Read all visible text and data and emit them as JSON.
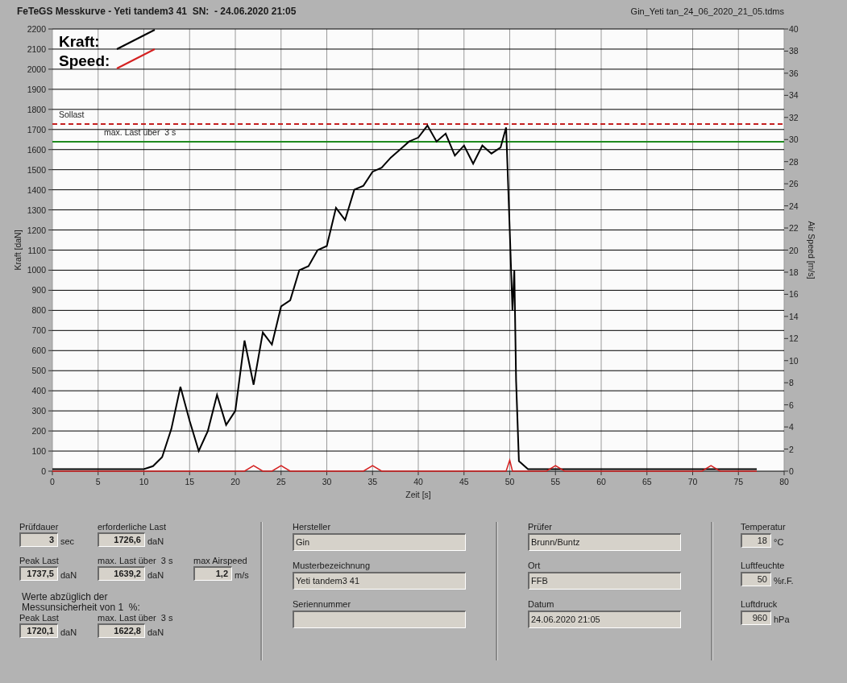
{
  "title": "FeTeGS Messkurve - Yeti tandem3 41  SN:  - 24.06.2020 21:05",
  "file_name": "Gin_Yeti tan_24_06_2020_21_05.tdms",
  "chart": {
    "chart_data": {
      "type": "line",
      "xlabel": "Zeit [s]",
      "ylabel": "Kraft [daN]",
      "y2label": "Air Speed [m/s]",
      "x": [
        0,
        1,
        2,
        3,
        4,
        5,
        6,
        7,
        8,
        9,
        10,
        11,
        12,
        13,
        14,
        15,
        16,
        17,
        18,
        19,
        20,
        21,
        22,
        23,
        24,
        25,
        26,
        27,
        28,
        29,
        30,
        31,
        32,
        33,
        34,
        35,
        36,
        37,
        38,
        39,
        40,
        41,
        42,
        43,
        44,
        45,
        46,
        47,
        48,
        49,
        49.6,
        50,
        50.3,
        50.5,
        50.7,
        51,
        52,
        53,
        54,
        55,
        56,
        57,
        58,
        59,
        60,
        61,
        62,
        63,
        64,
        65,
        66,
        67,
        68,
        69,
        70,
        71,
        72,
        73,
        74,
        75,
        76,
        77
      ],
      "series": [
        {
          "name": "Kraft:",
          "color": "#000000",
          "values": [
            10,
            10,
            10,
            10,
            10,
            10,
            10,
            10,
            10,
            10,
            10,
            25,
            70,
            210,
            420,
            250,
            100,
            200,
            380,
            230,
            300,
            650,
            430,
            690,
            630,
            820,
            850,
            1000,
            1020,
            1100,
            1120,
            1310,
            1250,
            1400,
            1420,
            1490,
            1510,
            1560,
            1600,
            1640,
            1660,
            1720,
            1640,
            1680,
            1570,
            1620,
            1530,
            1620,
            1580,
            1610,
            1710,
            1200,
            800,
            1000,
            450,
            50,
            10,
            10,
            10,
            10,
            10,
            10,
            10,
            10,
            10,
            10,
            10,
            10,
            10,
            10,
            10,
            10,
            10,
            10,
            10,
            10,
            10,
            10,
            10,
            10,
            10,
            10
          ]
        },
        {
          "name": "Speed:",
          "color": "#d42020",
          "axis": "y2",
          "values": [
            0,
            0,
            0,
            0,
            0,
            0,
            0,
            0,
            0,
            0,
            0,
            0,
            0,
            0,
            0,
            0,
            0,
            0,
            0,
            0,
            0,
            0,
            0.5,
            0,
            0,
            0.5,
            0,
            0,
            0,
            0,
            0,
            0,
            0,
            0,
            0,
            0.5,
            0,
            0,
            0,
            0,
            0,
            0,
            0,
            0,
            0,
            0,
            0,
            0,
            0,
            0,
            0,
            1,
            0,
            0,
            0,
            0,
            0,
            0,
            0,
            0.5,
            0,
            0,
            0,
            0,
            0,
            0,
            0,
            0,
            0,
            0,
            0,
            0,
            0,
            0,
            0,
            0,
            0.5,
            0,
            0,
            0,
            0,
            0
          ]
        }
      ],
      "xlim": [
        0,
        80
      ],
      "ylim": [
        0,
        2200
      ],
      "y2lim": [
        0,
        40
      ],
      "xticks": [
        0,
        5,
        10,
        15,
        20,
        25,
        30,
        35,
        40,
        45,
        50,
        55,
        60,
        65,
        70,
        75,
        80
      ],
      "yticks": [
        0,
        100,
        200,
        300,
        400,
        500,
        600,
        700,
        800,
        900,
        1000,
        1100,
        1200,
        1300,
        1400,
        1500,
        1600,
        1700,
        1800,
        1900,
        2000,
        2100,
        2200
      ],
      "y2ticks": [
        0,
        2,
        4,
        6,
        8,
        10,
        12,
        14,
        16,
        18,
        20,
        22,
        24,
        26,
        28,
        30,
        32,
        34,
        36,
        38,
        40
      ],
      "grid": true,
      "legend": "upper left",
      "ref_lines": [
        {
          "axis": "y",
          "value": 1727,
          "label": "Sollast",
          "color": "#c42020"
        },
        {
          "axis": "y",
          "value": 1639,
          "label": "max. Last über  3 s",
          "color": "#1e8a1e"
        }
      ]
    }
  },
  "results": {
    "rows": [
      [
        {
          "label": "Prüfdauer",
          "value": "3",
          "unit": "sec"
        },
        {
          "label": "erforderliche Last",
          "value": "1726,6",
          "unit": "daN"
        }
      ],
      [
        {
          "label": "Peak Last",
          "value": "1737,5",
          "unit": "daN"
        },
        {
          "label": "max. Last über  3 s",
          "value": "1639,2",
          "unit": "daN"
        },
        {
          "label": "max Airspeed",
          "value": "1,2",
          "unit": "m/s"
        }
      ]
    ],
    "note": "Werte abzüglich der\nMessunsicherheit von 1  %:",
    "corrected": [
      {
        "label": "Peak Last",
        "value": "1720,1",
        "unit": "daN"
      },
      {
        "label": "max. Last über  3 s",
        "value": "1622,8",
        "unit": "daN"
      }
    ]
  },
  "glider": [
    {
      "label": "Hersteller",
      "value": "Gin"
    },
    {
      "label": "Musterbezeichnung",
      "value": "Yeti tandem3 41"
    },
    {
      "label": "Seriennummer"
    }
  ],
  "test": [
    {
      "label": "Prüfer",
      "value": "Brunn/Buntz"
    },
    {
      "label": "Ort",
      "value": "FFB"
    },
    {
      "label": "Datum",
      "value": "24.06.2020 21:05"
    }
  ],
  "environment": [
    {
      "label": "Temperatur",
      "value": "18",
      "unit": "°C"
    },
    {
      "label": "Luftfeuchte",
      "value": "50",
      "unit": "%r.F."
    },
    {
      "label": "Luftdruck",
      "value": "960",
      "unit": "hPa"
    }
  ]
}
